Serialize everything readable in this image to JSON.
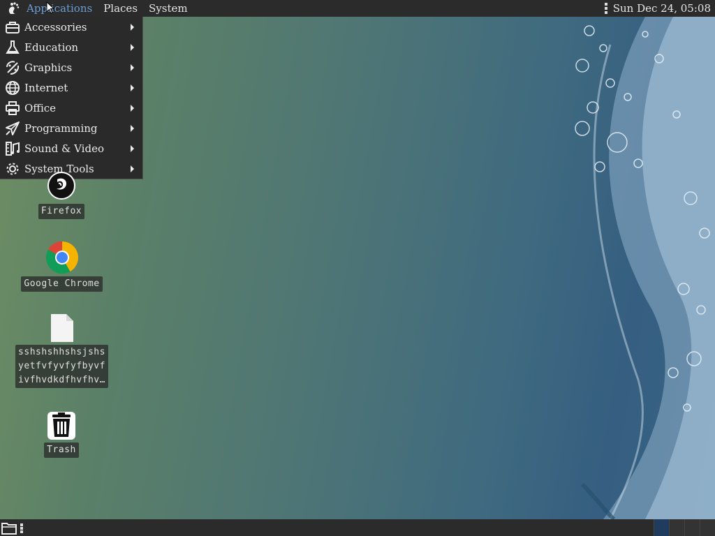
{
  "top_panel": {
    "menus": [
      "Applications",
      "Places",
      "System"
    ],
    "clock": "Sun Dec 24, 05:08"
  },
  "app_menu": {
    "items": [
      {
        "label": "Accessories",
        "icon": "toolbox-icon"
      },
      {
        "label": "Education",
        "icon": "flask-icon"
      },
      {
        "label": "Graphics",
        "icon": "palette-icon"
      },
      {
        "label": "Internet",
        "icon": "globe-icon"
      },
      {
        "label": "Office",
        "icon": "printer-icon"
      },
      {
        "label": "Programming",
        "icon": "send-arrow-icon"
      },
      {
        "label": "Sound & Video",
        "icon": "film-music-icon"
      },
      {
        "label": "System Tools",
        "icon": "gear-icon"
      }
    ]
  },
  "desktop": {
    "icons": [
      {
        "label": "Firefox",
        "icon": "firefox-icon"
      },
      {
        "label": "Google Chrome",
        "icon": "chrome-icon"
      },
      {
        "label": "sshshshhshsjshs\nyetfvfyvfyfbyvf\nivfhvdkdfhvfhv…",
        "icon": "text-file-icon"
      },
      {
        "label": "Trash",
        "icon": "trash-icon"
      }
    ]
  },
  "colors": {
    "panel": "#2b2b2b",
    "active_menu": "#6b9ed6",
    "workspace_active": "#1f3c5e"
  }
}
